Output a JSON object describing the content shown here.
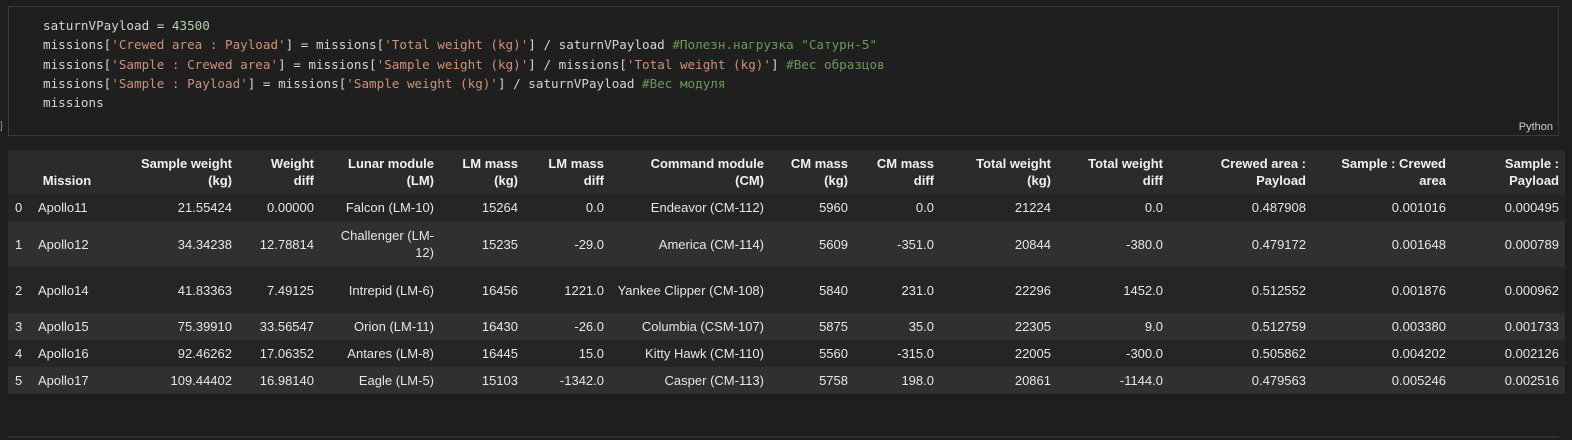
{
  "code_cell": {
    "lines": [
      [
        {
          "t": "saturnVPayload = ",
          "c": "plain"
        },
        {
          "t": "43500",
          "c": "num"
        }
      ],
      [
        {
          "t": "missions[",
          "c": "plain"
        },
        {
          "t": "'Crewed area : Payload'",
          "c": "str"
        },
        {
          "t": "] = missions[",
          "c": "plain"
        },
        {
          "t": "'Total weight (kg)'",
          "c": "str"
        },
        {
          "t": "] / saturnVPayload ",
          "c": "plain"
        },
        {
          "t": "#Полезн.нагрузка \"Сатурн-5\"",
          "c": "comment"
        }
      ],
      [
        {
          "t": "missions[",
          "c": "plain"
        },
        {
          "t": "'Sample : Crewed area'",
          "c": "str"
        },
        {
          "t": "] = missions[",
          "c": "plain"
        },
        {
          "t": "'Sample weight (kg)'",
          "c": "str"
        },
        {
          "t": "] / missions[",
          "c": "plain"
        },
        {
          "t": "'Total weight (kg)'",
          "c": "str"
        },
        {
          "t": "] ",
          "c": "plain"
        },
        {
          "t": "#Вес образцов",
          "c": "comment"
        }
      ],
      [
        {
          "t": "missions[",
          "c": "plain"
        },
        {
          "t": "'Sample : Payload'",
          "c": "str"
        },
        {
          "t": "] = missions[",
          "c": "plain"
        },
        {
          "t": "'Sample weight (kg)'",
          "c": "str"
        },
        {
          "t": "] / saturnVPayload ",
          "c": "plain"
        },
        {
          "t": "#Вес модуля",
          "c": "comment"
        }
      ],
      [
        {
          "t": "missions",
          "c": "plain"
        }
      ]
    ],
    "language": "Python",
    "bracket": "]"
  },
  "table": {
    "columns": [
      [
        "",
        ""
      ],
      [
        "",
        "Mission"
      ],
      [
        "Sample weight",
        "(kg)"
      ],
      [
        "Weight",
        "diff"
      ],
      [
        "Lunar module",
        "(LM)"
      ],
      [
        "LM mass",
        "(kg)"
      ],
      [
        "LM mass",
        "diff"
      ],
      [
        "Command module",
        "(CM)"
      ],
      [
        "CM mass",
        "(kg)"
      ],
      [
        "CM mass",
        "diff"
      ],
      [
        "Total weight",
        "(kg)"
      ],
      [
        "Total weight",
        "diff"
      ],
      [
        "Crewed area :",
        "Payload"
      ],
      [
        "Sample : Crewed",
        "area"
      ],
      [
        "Sample :",
        "Payload"
      ]
    ],
    "rows": [
      [
        "0",
        "Apollo11",
        "21.55424",
        "0.00000",
        "Falcon (LM-10)",
        "15264",
        "0.0",
        "Endeavor (CM-112)",
        "5960",
        "0.0",
        "21224",
        "0.0",
        "0.487908",
        "0.001016",
        "0.000495"
      ],
      [
        "1",
        "Apollo12",
        "34.34238",
        "12.78814",
        "Challenger (LM-12)",
        "15235",
        "-29.0",
        "America (CM-114)",
        "5609",
        "-351.0",
        "20844",
        "-380.0",
        "0.479172",
        "0.001648",
        "0.000789"
      ],
      [
        "2",
        "Apollo14",
        "41.83363",
        "7.49125",
        "Intrepid (LM-6)",
        "16456",
        "1221.0",
        "Yankee Clipper (CM-108)",
        "5840",
        "231.0",
        "22296",
        "1452.0",
        "0.512552",
        "0.001876",
        "0.000962"
      ],
      [
        "3",
        "Apollo15",
        "75.39910",
        "33.56547",
        "Orion (LM-11)",
        "16430",
        "-26.0",
        "Columbia (CSM-107)",
        "5875",
        "35.0",
        "22305",
        "9.0",
        "0.512759",
        "0.003380",
        "0.001733"
      ],
      [
        "4",
        "Apollo16",
        "92.46262",
        "17.06352",
        "Antares (LM-8)",
        "16445",
        "15.0",
        "Kitty Hawk (CM-110)",
        "5560",
        "-315.0",
        "22005",
        "-300.0",
        "0.505862",
        "0.004202",
        "0.002126"
      ],
      [
        "5",
        "Apollo17",
        "109.44402",
        "16.98140",
        "Eagle (LM-5)",
        "15103",
        "-1342.0",
        "Casper (CM-113)",
        "5758",
        "198.0",
        "20861",
        "-1144.0",
        "0.479563",
        "0.005246",
        "0.002516"
      ]
    ]
  }
}
